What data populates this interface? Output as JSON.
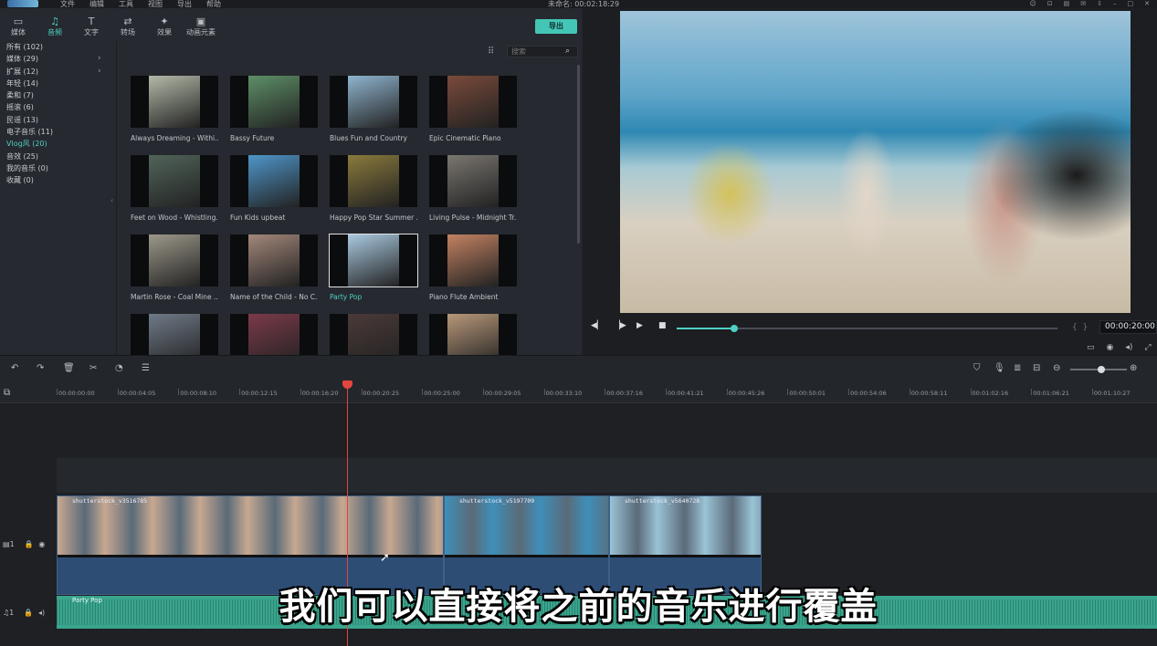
{
  "menubar": {
    "menu": [
      "文件",
      "编辑",
      "工具",
      "视图",
      "导出",
      "帮助"
    ],
    "title": "未命名: 00:02:18:29"
  },
  "tabs": [
    {
      "label": "媒体",
      "icon": "folder-icon",
      "glyph": "▭"
    },
    {
      "label": "音频",
      "icon": "music-note-icon",
      "glyph": "♫"
    },
    {
      "label": "文字",
      "icon": "text-icon",
      "glyph": "T"
    },
    {
      "label": "转场",
      "icon": "transition-icon",
      "glyph": "⇄"
    },
    {
      "label": "效果",
      "icon": "effects-icon",
      "glyph": "✦"
    },
    {
      "label": "动画元素",
      "icon": "image-icon",
      "glyph": "▣"
    }
  ],
  "active_tab": 1,
  "export_label": "导出",
  "categories": [
    {
      "label": "所有 (102)"
    },
    {
      "label": "媒体 (29)",
      "arrow": true
    },
    {
      "label": "扩展 (12)",
      "arrow": true
    },
    {
      "label": "年轻 (14)"
    },
    {
      "label": "柔和 (7)"
    },
    {
      "label": "摇滚 (6)"
    },
    {
      "label": "民谣 (13)"
    },
    {
      "label": "电子音乐 (11)"
    },
    {
      "label": "Vlog风 (20)",
      "active": true
    },
    {
      "label": "音效 (25)"
    },
    {
      "label": "我的音乐 (0)"
    },
    {
      "label": "收藏 (0)"
    }
  ],
  "search": {
    "placeholder": "搜索"
  },
  "library_items": [
    {
      "label": "Always Dreaming - Withi...",
      "color": "#b3b9a8"
    },
    {
      "label": "Bassy Future",
      "color": "#5d8f67"
    },
    {
      "label": "Blues Fun and Country",
      "color": "#8fb4cf"
    },
    {
      "label": "Epic Cinematic Piano",
      "color": "#7a4a3a"
    },
    {
      "label": "Feet on Wood - Whistling...",
      "color": "#51645a"
    },
    {
      "label": "Fun Kids upbeat",
      "color": "#4e96c9"
    },
    {
      "label": "Happy Pop Star Summer ...",
      "color": "#8a7a3c"
    },
    {
      "label": "Living Pulse - Midnight Tr...",
      "color": "#7a7670"
    },
    {
      "label": "Martin Rose - Coal Mine ...",
      "color": "#9c988a"
    },
    {
      "label": "Name of the Child - No C...",
      "color": "#a3877a"
    },
    {
      "label": "Party Pop",
      "color": "#a9c9e0",
      "selected": true
    },
    {
      "label": "Piano Flute Ambient",
      "color": "#c38262"
    },
    {
      "label": "",
      "color": "#6f7a88"
    },
    {
      "label": "",
      "color": "#7b3a4a"
    },
    {
      "label": "",
      "color": "#4a3a38"
    },
    {
      "label": "",
      "color": "#b8987a"
    }
  ],
  "preview": {
    "timecode": "00:00:20:00",
    "progress": 0.15
  },
  "ruler_ticks": [
    "00:00:00:00",
    "00:00:04:05",
    "00:00:08:10",
    "00:00:12:15",
    "00:00:16:20",
    "00:00:20:25",
    "00:00:25:00",
    "00:00:29:05",
    "00:00:33:10",
    "00:00:37:16",
    "00:00:41:21",
    "00:00:45:26",
    "00:00:50:01",
    "00:00:54:06",
    "00:00:58:11",
    "00:01:02:16",
    "00:01:06:21",
    "00:01:10:27"
  ],
  "clips": [
    {
      "name": "shutterstock_v3516785",
      "color": "#c7a891"
    },
    {
      "name": "shutterstock_v5197709",
      "color": "#3f8fb9"
    },
    {
      "name": "shutterstock_v5640728",
      "color": "#9ac3d6"
    }
  ],
  "audio_clip": {
    "name": "Party Pop"
  },
  "track_labels": {
    "video": "1",
    "audio": "1"
  },
  "subtitle": "我们可以直接将之前的音乐进行覆盖",
  "colors": {
    "accent": "#4fd0c4",
    "playhead": "#e3453f",
    "audio": "#3aa58d",
    "video_clip": "#2d4d75"
  }
}
